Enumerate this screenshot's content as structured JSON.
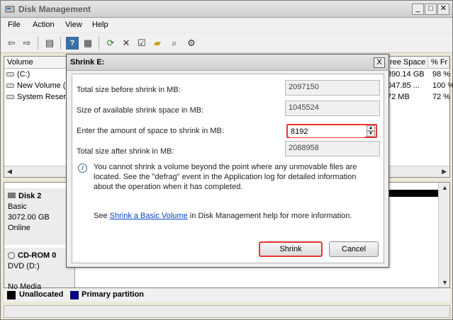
{
  "window": {
    "title": "Disk Management",
    "controls": {
      "minimize": "_",
      "maximize": "□",
      "close": "✕"
    }
  },
  "menu": [
    "File",
    "Action",
    "View",
    "Help"
  ],
  "toolbar_icons": [
    "back-icon",
    "forward-icon",
    "console-tree-icon",
    "help-icon",
    "properties-pane-icon",
    "refresh-icon",
    "delete-icon",
    "properties-icon",
    "open-folder-icon",
    "search-icon",
    "settings-icon"
  ],
  "volume_list": {
    "columns": [
      "Volume",
      "ree Space",
      "% Fr"
    ],
    "rows": [
      {
        "name": "(C:)",
        "free": "390.14 GB",
        "pct": "98 %"
      },
      {
        "name": "New Volume (I",
        "free": "047.85 ...",
        "pct": "100 %"
      },
      {
        "name": "System Reser",
        "free": "72 MB",
        "pct": "72 %"
      }
    ]
  },
  "disks": [
    {
      "title": "Disk 2",
      "type": "Basic",
      "size": "3072.00 GB",
      "status": "Online"
    },
    {
      "title": "CD-ROM 0",
      "type": "DVD (D:)",
      "size": "",
      "status": "No Media"
    }
  ],
  "legend": [
    {
      "label": "Unallocated",
      "color": "#000000"
    },
    {
      "label": "Primary partition",
      "color": "#000080"
    }
  ],
  "dialog": {
    "title": "Shrink E:",
    "close": "X",
    "total_before_label": "Total size before shrink in MB:",
    "total_before_value": "2097150",
    "available_label": "Size of available shrink space in MB:",
    "available_value": "1045524",
    "amount_label": "Enter the amount of space to shrink in MB:",
    "amount_value": "8192",
    "total_after_label": "Total size after shrink in MB:",
    "total_after_value": "2088958",
    "info_text": "You cannot shrink a volume beyond the point where any unmovable files are located. See the \"defrag\" event in the Application log for detailed information about the operation when it has completed.",
    "help_prefix": "See",
    "help_link": "Shrink a Basic Volume",
    "help_suffix": "in Disk Management help for more information.",
    "shrink_button": "Shrink",
    "cancel_button": "Cancel"
  }
}
